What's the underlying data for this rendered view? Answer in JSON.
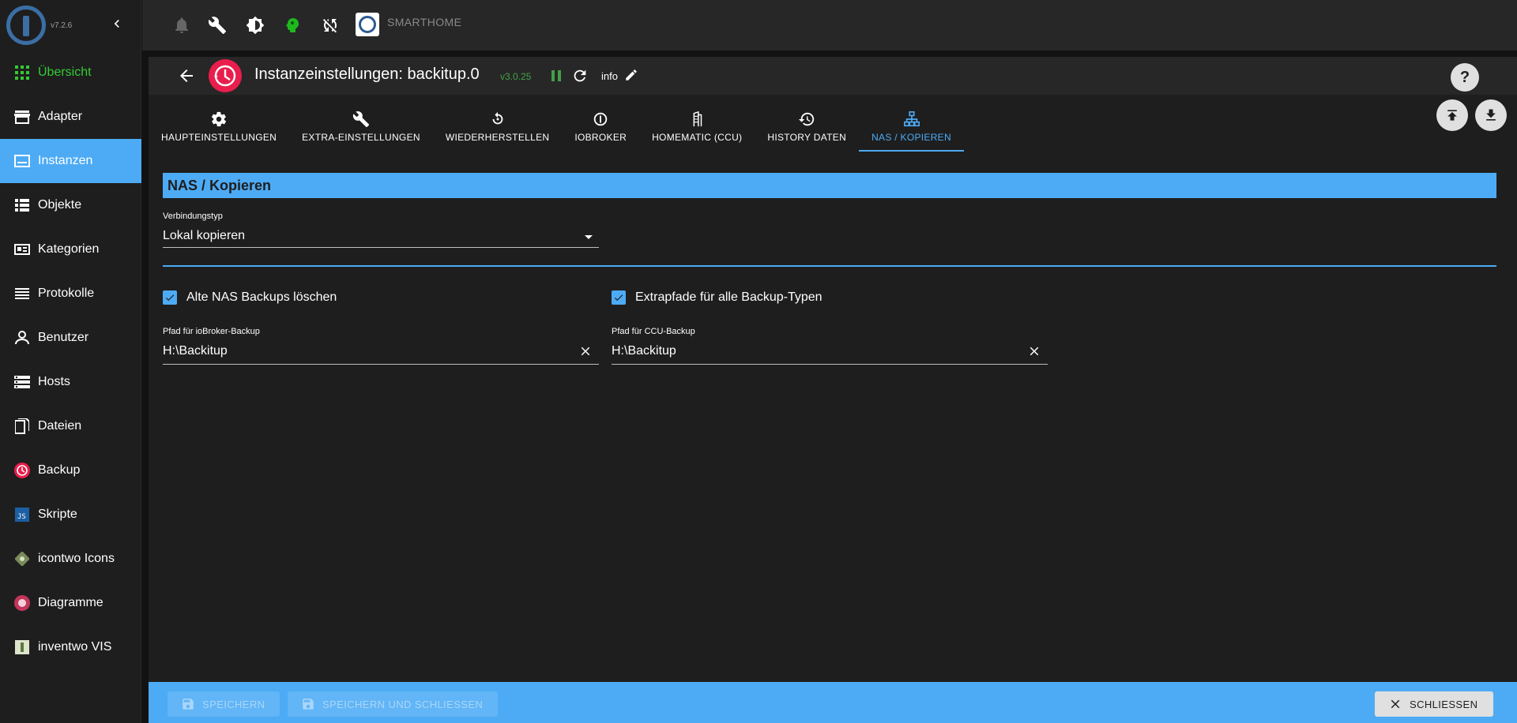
{
  "sidebar": {
    "version": "v7.2.6",
    "items": [
      {
        "label": "Übersicht",
        "icon": "grid-icon"
      },
      {
        "label": "Adapter",
        "icon": "store-icon"
      },
      {
        "label": "Instanzen",
        "icon": "instances-icon"
      },
      {
        "label": "Objekte",
        "icon": "list-icon"
      },
      {
        "label": "Kategorien",
        "icon": "categories-icon"
      },
      {
        "label": "Protokolle",
        "icon": "log-icon"
      },
      {
        "label": "Benutzer",
        "icon": "user-icon"
      },
      {
        "label": "Hosts",
        "icon": "hosts-icon"
      },
      {
        "label": "Dateien",
        "icon": "files-icon"
      },
      {
        "label": "Backup",
        "icon": "backup-icon"
      },
      {
        "label": "Skripte",
        "icon": "js-icon"
      },
      {
        "label": "icontwo Icons",
        "icon": "icontwo-icon"
      },
      {
        "label": "Diagramme",
        "icon": "chart-icon"
      },
      {
        "label": "inventwo VIS",
        "icon": "vis-icon"
      }
    ]
  },
  "topbar": {
    "brand": "SMARTHOME"
  },
  "header": {
    "title": "Instanzeinstellungen: backitup.0",
    "version": "v3.0.25",
    "info": "info"
  },
  "tabs": [
    {
      "label": "HAUPTEINSTELLUNGEN",
      "icon": "gear-icon"
    },
    {
      "label": "EXTRA-EINSTELLUNGEN",
      "icon": "wrench-icon"
    },
    {
      "label": "WIEDERHERSTELLEN",
      "icon": "restore-icon"
    },
    {
      "label": "IOBROKER",
      "icon": "iobroker-icon"
    },
    {
      "label": "HOMEMATIC (CCU)",
      "icon": "homematic-icon"
    },
    {
      "label": "HISTORY DATEN",
      "icon": "history-icon"
    },
    {
      "label": "NAS / KOPIEREN",
      "icon": "network-icon"
    }
  ],
  "content": {
    "section_title": "NAS / Kopieren",
    "connection_type_label": "Verbindungstyp",
    "connection_type_value": "Lokal kopieren",
    "delete_old_label": "Alte NAS Backups löschen",
    "extra_paths_label": "Extrapfade für alle Backup-Typen",
    "iobroker_path_label": "Pfad für ioBroker-Backup",
    "iobroker_path_value": "H:\\Backitup",
    "ccu_path_label": "Pfad für CCU-Backup",
    "ccu_path_value": "H:\\Backitup"
  },
  "footer": {
    "save": "SPEICHERN",
    "save_close": "SPEICHERN UND SCHLIESSEN",
    "close": "SCHLIESSEN"
  },
  "colors": {
    "accent": "#4dabf5",
    "active_green": "#33cc33",
    "backup_red": "#e91e4c"
  }
}
